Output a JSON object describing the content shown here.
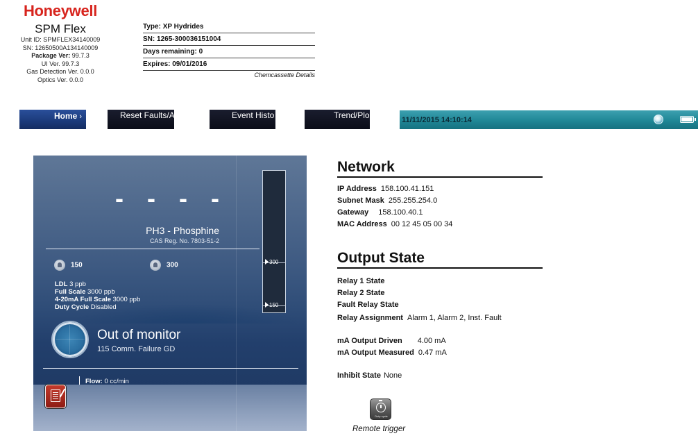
{
  "brand": {
    "logo": "Honeywell",
    "model": "SPM Flex",
    "unit_id": "Unit ID: SPMFLEX34140009",
    "sn": "SN: 12650500A134140009",
    "package_label": "Package Ver:",
    "package_value": "99.7.3",
    "ui_ver": "UI Ver. 99.7.3",
    "gas_det_ver": "Gas Detection Ver. 0.0.0",
    "optics_ver": "Optics Ver. 0.0.0"
  },
  "cassette": {
    "type_label": "Type:",
    "type_value": "XP Hydrides",
    "sn_label": "SN:",
    "sn_value": "1265-300036151004",
    "days_label": "Days remaining:",
    "days_value": "0",
    "expires_label": "Expires:",
    "expires_value": "09/01/2016",
    "details_link": "Chemcassette Details"
  },
  "nav": {
    "home": "Home",
    "home_chevron": "›",
    "reset": "Reset Faults/A",
    "event": "Event Histo",
    "trend": "Trend/Plo"
  },
  "statusbar": {
    "datetime": "11/11/2015 14:10:14",
    "icons": [
      "globe-icon",
      "battery-icon"
    ]
  },
  "monitor": {
    "reading": "- - - -",
    "gas_name": "PH3 - Phosphine",
    "cas": "CAS Reg. No. 7803-51-2",
    "alarm1": "150",
    "alarm2": "300",
    "ldl_label": "LDL",
    "ldl_value": "3 ppb",
    "fullscale_label": "Full Scale",
    "fullscale_value": "3000 ppb",
    "ma_fullscale_label": "4-20mA Full Scale",
    "ma_fullscale_value": "3000 ppb",
    "duty_label": "Duty Cycle",
    "duty_value": "Disabled",
    "bar_mark_high": "300",
    "bar_mark_low": "150",
    "state_title": "Out of monitor",
    "state_sub": "115 Comm. Failure GD",
    "flow_label": "Flow:",
    "flow_value": "0 cc/min"
  },
  "network": {
    "title": "Network",
    "ip_label": "IP Address",
    "ip_value": "158.100.41.151",
    "subnet_label": "Subnet Mask",
    "subnet_value": "255.255.254.0",
    "gateway_label": "Gateway",
    "gateway_value": "158.100.40.1",
    "mac_label": "MAC Address",
    "mac_value": "00 12 45 05 00 34"
  },
  "output": {
    "title": "Output State",
    "relay1_label": "Relay 1 State",
    "relay2_label": "Relay 2 State",
    "fault_relay_label": "Fault Relay State",
    "assignment_label": "Relay Assignment",
    "assignment_value": "Alarm 1, Alarm 2, Inst. Fault",
    "ma_driven_label": "mA Output Driven",
    "ma_driven_value": "4.00 mA",
    "ma_measured_label": "mA Output Measured",
    "ma_measured_value": "0.47 mA",
    "inhibit_label": "Inhibit State",
    "inhibit_value": "None"
  },
  "remote": {
    "icon_text": "Duty cycle",
    "label": "Remote trigger"
  }
}
